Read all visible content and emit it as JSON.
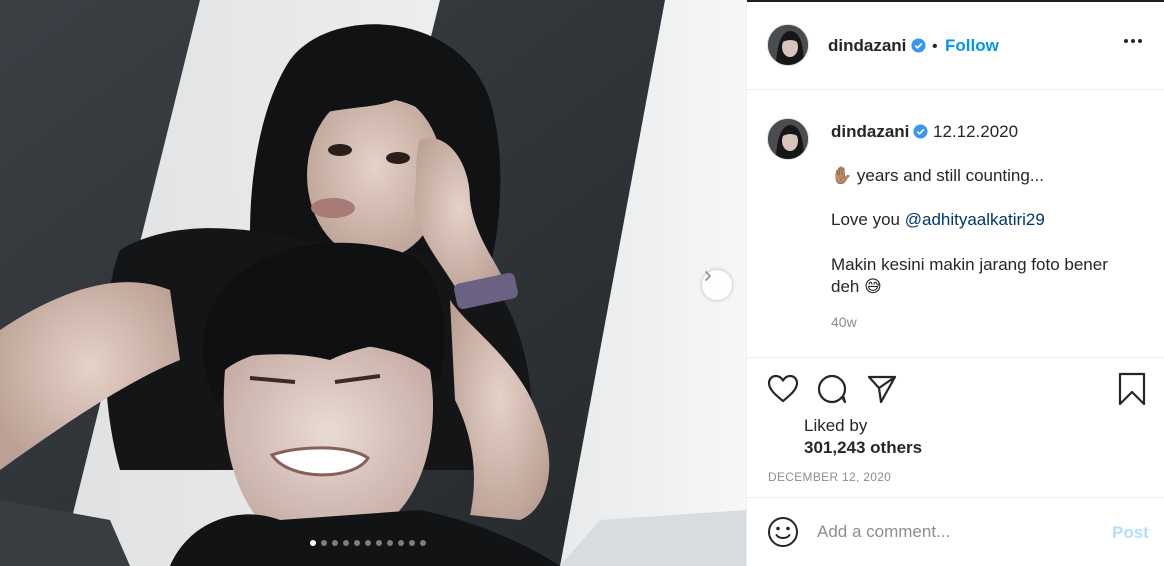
{
  "post": {
    "username": "dindazani",
    "follow_label": "Follow",
    "separator": "•",
    "caption_date": "12.12.2020",
    "caption_line1": "years and still counting...",
    "caption_line1_emoji": "✋🏽",
    "caption_love": "Love you ",
    "caption_mention": "@adhityaalkatiri29",
    "caption_line3a": "Makin kesini makin jarang foto bener",
    "caption_line3b": "deh",
    "caption_line3_emoji": "😅",
    "age": "40w",
    "liked_by": "Liked by",
    "likes_count": "301,243 others",
    "post_date": "DECEMBER 12, 2020"
  },
  "comment": {
    "placeholder": "Add a comment...",
    "post_label": "Post"
  },
  "carousel": {
    "total_dots": 11,
    "active_index": 0
  },
  "colors": {
    "accent": "#0095f6",
    "verified": "#3897f0",
    "post_disabled": "#b2dffc",
    "muted": "#8e8e8e"
  },
  "icons": [
    "verified-badge-icon",
    "more-options-icon",
    "heart-icon",
    "comment-icon",
    "share-icon",
    "bookmark-icon",
    "smiley-icon",
    "chevron-right-icon"
  ]
}
